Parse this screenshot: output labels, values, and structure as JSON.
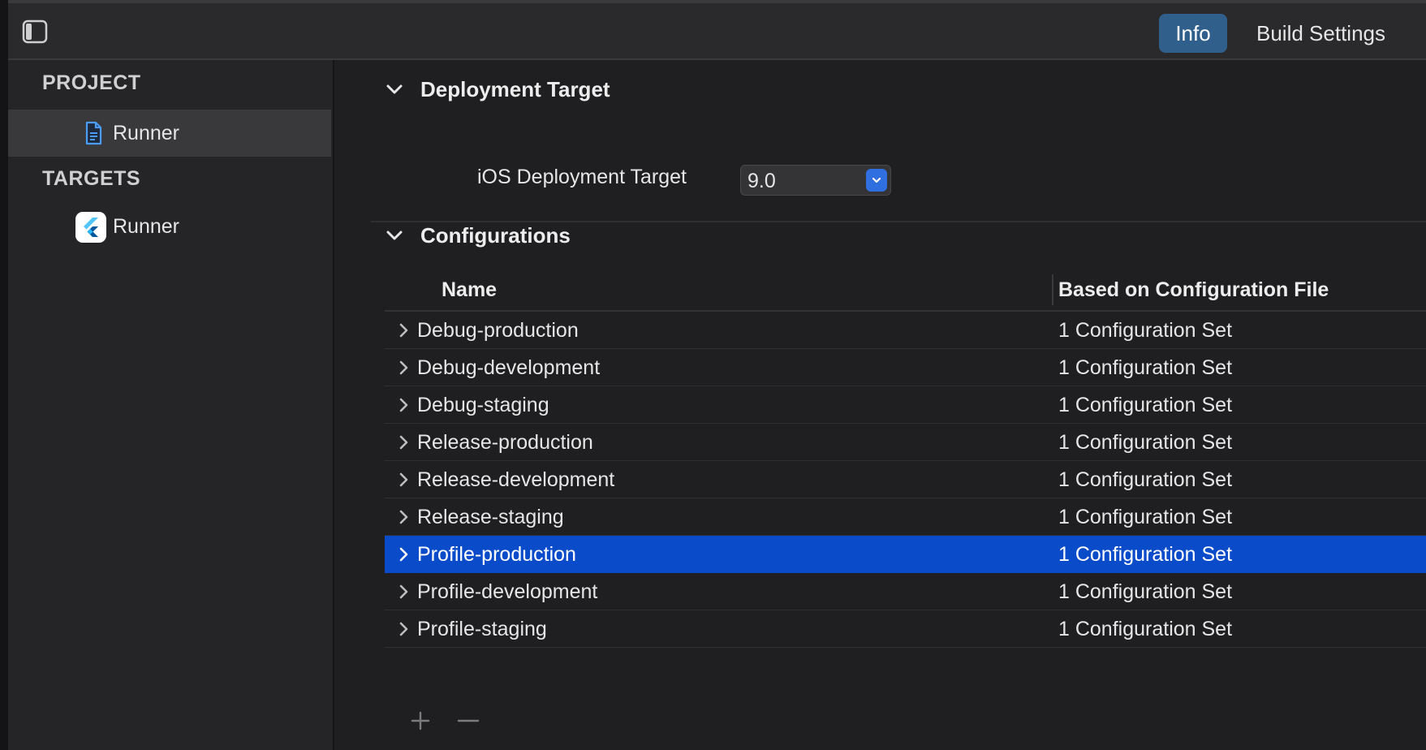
{
  "toolbar": {
    "tabs": [
      {
        "label": "Info",
        "active": true
      },
      {
        "label": "Build Settings",
        "active": false
      }
    ],
    "sidebar_toggle_icon": "sidebar-toggle-icon"
  },
  "sidebar": {
    "project_heading": "PROJECT",
    "project_items": [
      {
        "label": "Runner",
        "icon": "project-file-icon",
        "selected": true
      }
    ],
    "targets_heading": "TARGETS",
    "target_items": [
      {
        "label": "Runner",
        "icon": "flutter-app-icon",
        "selected": false
      }
    ]
  },
  "deployment": {
    "title": "Deployment Target",
    "ios_label": "iOS Deployment Target",
    "ios_value": "9.0"
  },
  "configurations": {
    "title": "Configurations",
    "columns": {
      "name": "Name",
      "based_on": "Based on Configuration File"
    },
    "rows": [
      {
        "name": "Debug-production",
        "based_on": "1 Configuration Set",
        "selected": false
      },
      {
        "name": "Debug-development",
        "based_on": "1 Configuration Set",
        "selected": false
      },
      {
        "name": "Debug-staging",
        "based_on": "1 Configuration Set",
        "selected": false
      },
      {
        "name": "Release-production",
        "based_on": "1 Configuration Set",
        "selected": false
      },
      {
        "name": "Release-development",
        "based_on": "1 Configuration Set",
        "selected": false
      },
      {
        "name": "Release-staging",
        "based_on": "1 Configuration Set",
        "selected": false
      },
      {
        "name": "Profile-production",
        "based_on": "1 Configuration Set",
        "selected": true
      },
      {
        "name": "Profile-development",
        "based_on": "1 Configuration Set",
        "selected": false
      },
      {
        "name": "Profile-staging",
        "based_on": "1 Configuration Set",
        "selected": false
      }
    ],
    "add_icon": "plus-icon",
    "remove_icon": "minus-icon"
  },
  "colors": {
    "accent_selected_row": "#0a4bc9",
    "active_tab": "#2f5f8a",
    "popup_button": "#2f6fe0"
  }
}
